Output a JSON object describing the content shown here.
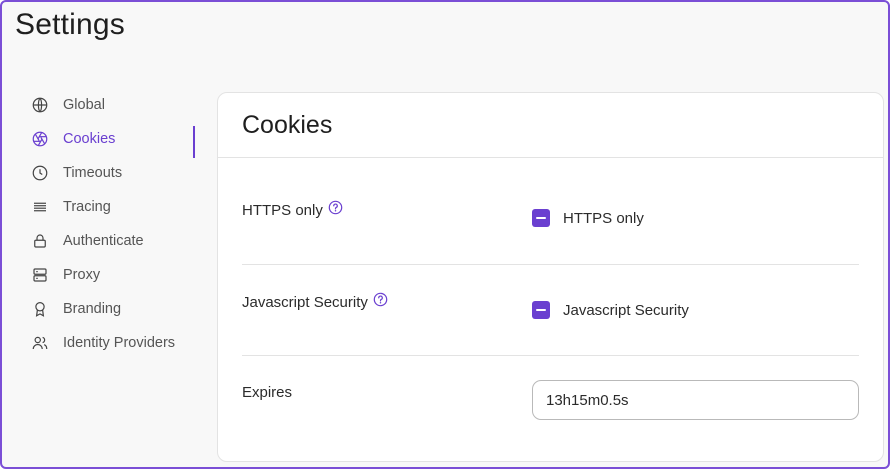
{
  "page": {
    "title": "Settings"
  },
  "sidebar": {
    "items": [
      {
        "label": "Global",
        "icon": "globe-icon",
        "active": false
      },
      {
        "label": "Cookies",
        "icon": "cookie-aperture-icon",
        "active": true
      },
      {
        "label": "Timeouts",
        "icon": "clock-icon",
        "active": false
      },
      {
        "label": "Tracing",
        "icon": "lines-icon",
        "active": false
      },
      {
        "label": "Authenticate",
        "icon": "lock-icon",
        "active": false
      },
      {
        "label": "Proxy",
        "icon": "server-icon",
        "active": false
      },
      {
        "label": "Branding",
        "icon": "award-icon",
        "active": false
      },
      {
        "label": "Identity Providers",
        "icon": "users-icon",
        "active": false
      }
    ]
  },
  "card": {
    "title": "Cookies",
    "https_only": {
      "label": "HTTPS only",
      "checkbox_label": "HTTPS only",
      "state": "indeterminate"
    },
    "javascript_security": {
      "label": "Javascript Security",
      "checkbox_label": "Javascript Security",
      "state": "indeterminate"
    },
    "expires": {
      "label": "Expires",
      "value": "13h15m0.5s"
    }
  },
  "colors": {
    "accent": "#6a3fd0",
    "frame": "#7b4fd6"
  }
}
